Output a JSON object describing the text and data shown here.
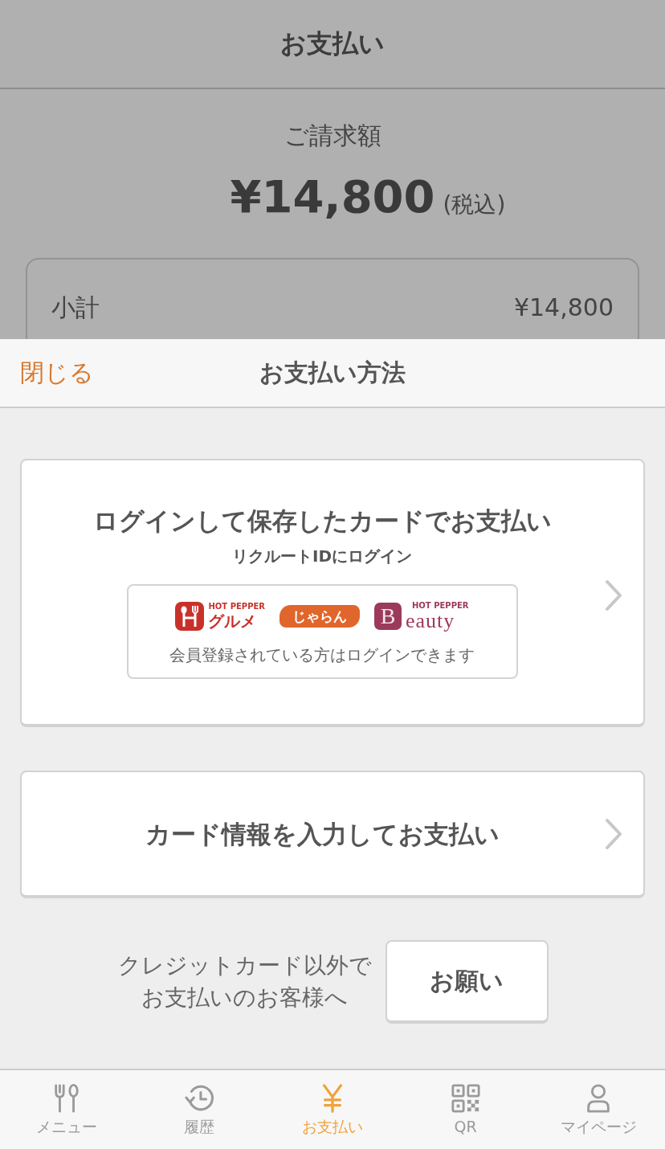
{
  "background_page": {
    "title": "お支払い",
    "billing_label": "ご請求額",
    "amount": "¥14,800",
    "tax_note": "(税込)",
    "breakdown": [
      {
        "label": "小計",
        "value": "¥14,800"
      }
    ]
  },
  "sheet": {
    "close": "閉じる",
    "title": "お支払い方法"
  },
  "options": [
    {
      "kind": "login",
      "title": "ログインして保存したカードでお支払い",
      "subtitle": "リクルートIDにログイン",
      "logos": [
        {
          "kind": "gourmet",
          "top": "HOT PEPPER",
          "name": "グルメ"
        },
        {
          "kind": "jalan",
          "name": "じゃらん"
        },
        {
          "kind": "beauty",
          "top": "HOT PEPPER",
          "initial": "B",
          "name": "eauty"
        }
      ],
      "note": "会員登録されている方はログインできます"
    },
    {
      "kind": "card",
      "title": "カード情報を入力してお支払い"
    }
  ],
  "other_payment": {
    "text": "クレジットカード以外でお支払いのお客様へ",
    "button": "お願い"
  },
  "tab_bar": [
    {
      "kind": "menu",
      "label": "メニュー",
      "selected": false
    },
    {
      "kind": "history",
      "label": "履歴",
      "selected": false
    },
    {
      "kind": "payment",
      "label": "お支払い",
      "selected": true
    },
    {
      "kind": "qr",
      "label": "QR",
      "selected": false
    },
    {
      "kind": "mypage",
      "label": "マイページ",
      "selected": false
    }
  ]
}
